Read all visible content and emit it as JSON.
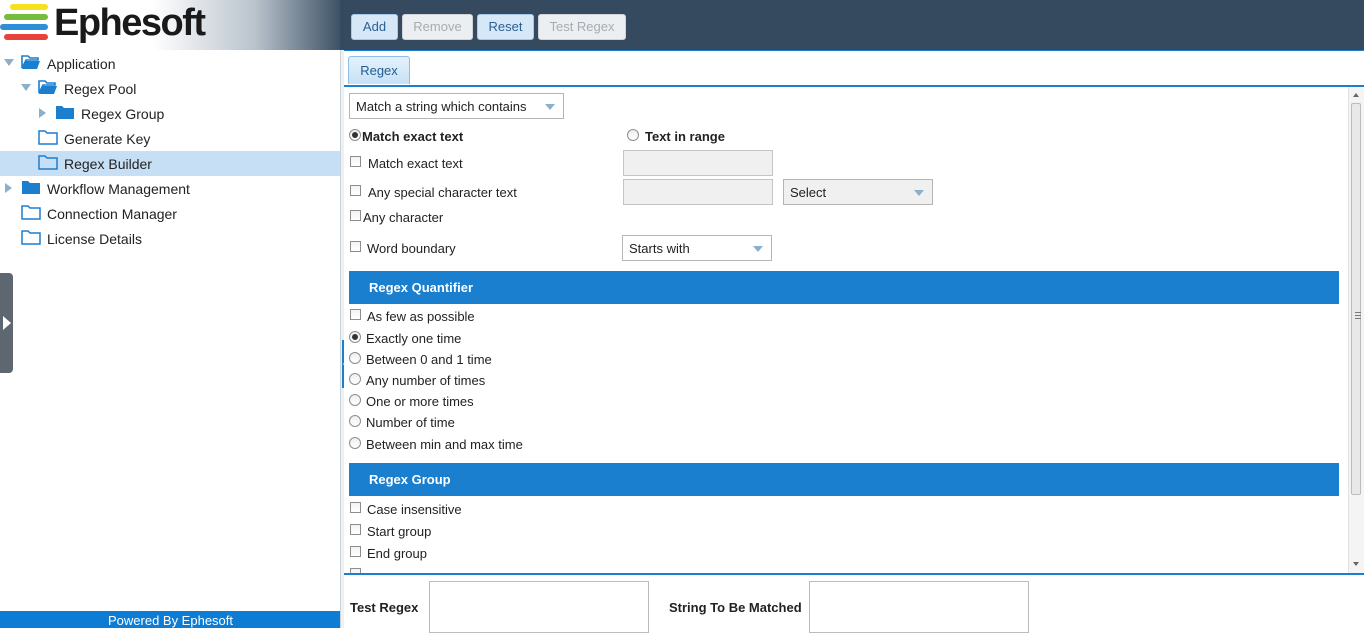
{
  "app": {
    "logo_text": "Ephesoft",
    "logo_colors": [
      "#f6e21a",
      "#76bd3d",
      "#2f8fd6",
      "#e8433b"
    ],
    "powered_by": "Powered By Ephesoft"
  },
  "toolbar": {
    "add_label": "Add",
    "remove_label": "Remove",
    "reset_label": "Reset",
    "test_regex_label": "Test Regex"
  },
  "tree": {
    "items": [
      {
        "label": "Application"
      },
      {
        "label": "Regex Pool"
      },
      {
        "label": "Regex Group"
      },
      {
        "label": "Generate Key"
      },
      {
        "label": "Regex Builder"
      },
      {
        "label": "Workflow Management"
      },
      {
        "label": "Connection Manager"
      },
      {
        "label": "License Details"
      }
    ]
  },
  "tabs": [
    {
      "label": "Regex"
    }
  ],
  "builder": {
    "match_type_dropdown": "Match a string which contains",
    "mode_exact_label": "Match exact text",
    "mode_range_label": "Text in range",
    "opt_match_exact": "Match exact text",
    "opt_special_char": "Any special character text",
    "special_char_select": "Select",
    "opt_any_char": "Any character",
    "opt_word_boundary": "Word boundary",
    "word_boundary_select": "Starts with"
  },
  "quantifier": {
    "header": "Regex Quantifier",
    "few_as_possible": "As few as possible",
    "options": [
      "Exactly one time",
      "Between 0 and 1 time",
      "Any number of times",
      "One or more times",
      "Number of time",
      "Between min and max time"
    ],
    "selected": "Exactly one time"
  },
  "group": {
    "header": "Regex Group",
    "options": [
      "Case insensitive",
      "Start group",
      "End group"
    ]
  },
  "test": {
    "test_regex_label": "Test Regex",
    "string_to_match_label": "String To Be Matched"
  },
  "colors": {
    "header_bg": "#354a5f",
    "accent": "#1b7fd0",
    "selected_row": "#c6dff4"
  }
}
